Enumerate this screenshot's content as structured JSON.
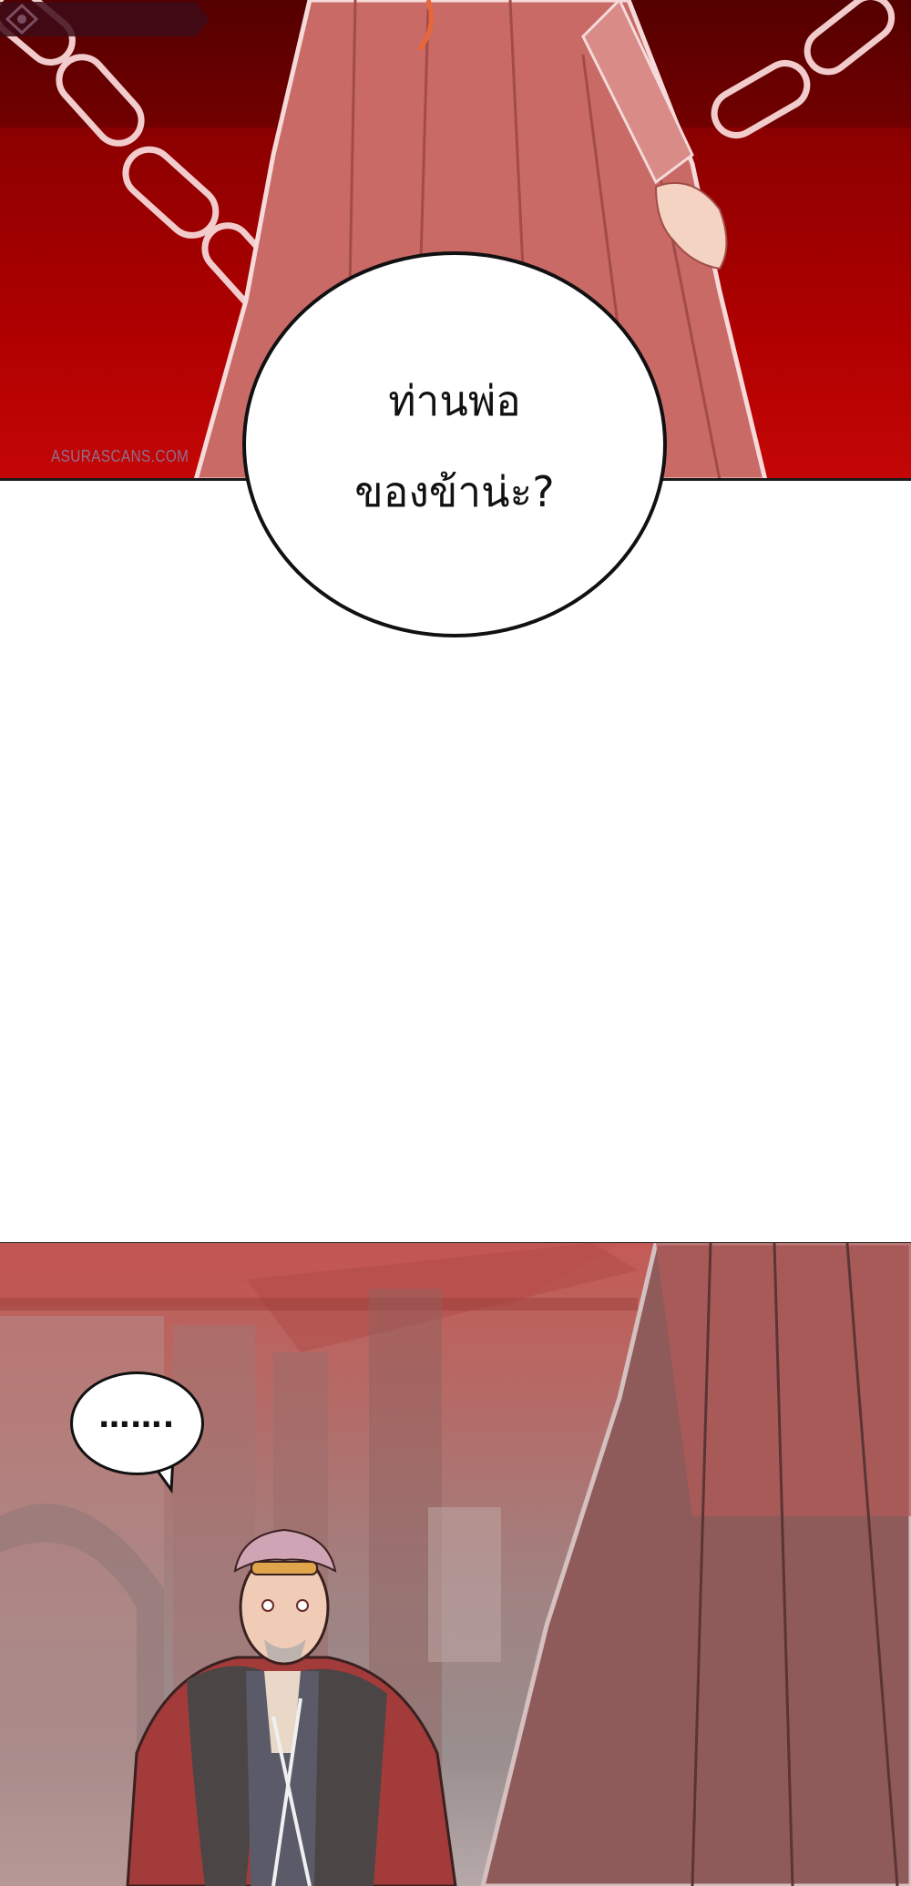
{
  "panels": {
    "top": {
      "watermark": "ASURASCANS.COM",
      "speech_bubble": {
        "lines": [
          "ท่านพ่อ",
          "ของข้าน่ะ?"
        ]
      }
    },
    "bottom": {
      "speech_bubble": {
        "text": "……."
      }
    }
  },
  "colors": {
    "top_background": "#b00000",
    "robe": "#c96a66",
    "chain": "#f3d6d6",
    "bottom_background": "#b46b67",
    "cloak": "#a33b3a",
    "fur": "#4b4545"
  }
}
